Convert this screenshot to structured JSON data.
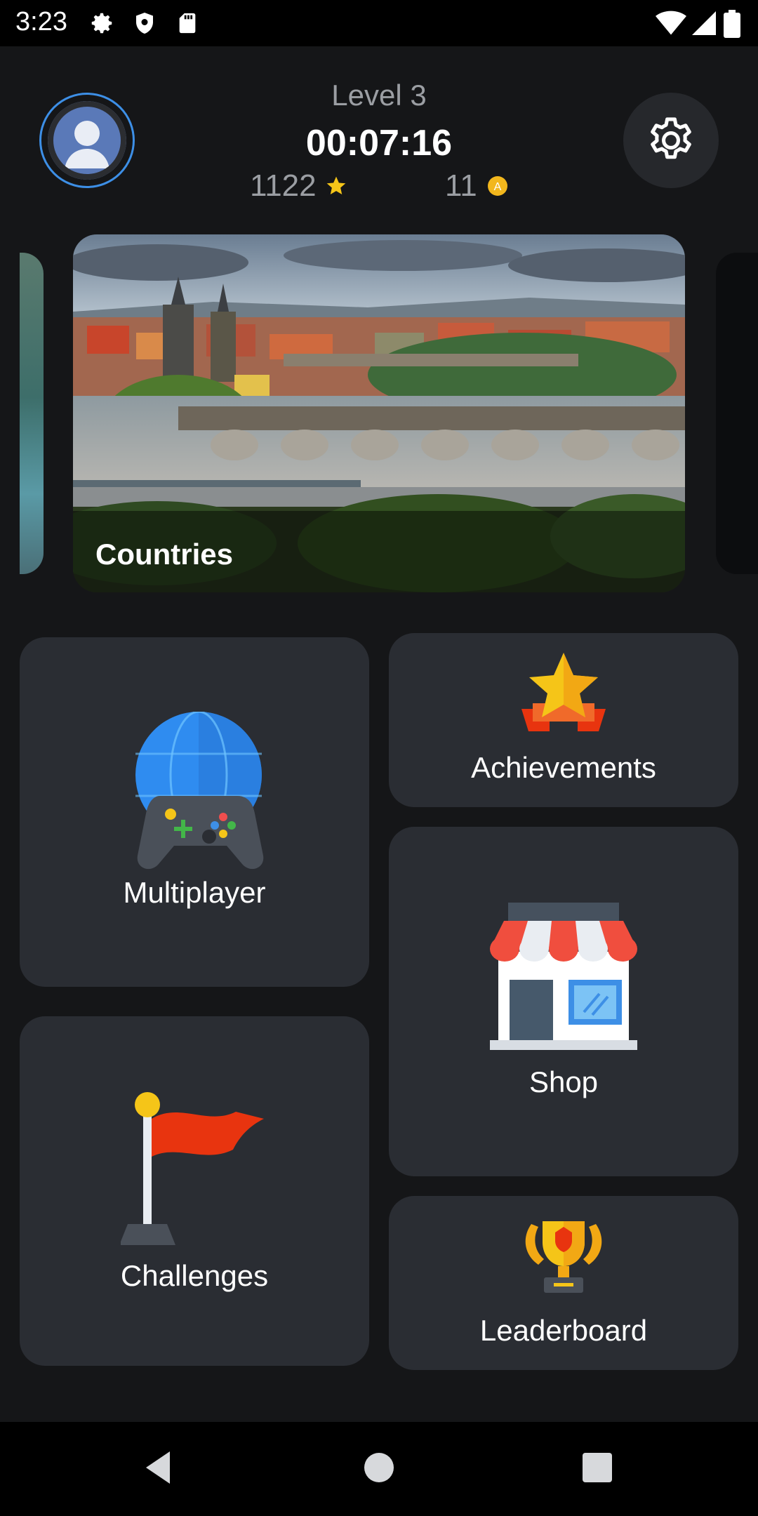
{
  "status_bar": {
    "time": "3:23",
    "icons": [
      "gear-icon",
      "shield-icon",
      "sd-card-icon",
      "wifi-icon",
      "signal-icon",
      "battery-icon"
    ]
  },
  "header": {
    "level": "Level 3",
    "timer": "00:07:16",
    "stars": "1122",
    "coins": "11",
    "coin_symbol": "A"
  },
  "carousel": {
    "current_card": "Countries"
  },
  "menu": {
    "multiplayer": "Multiplayer",
    "achievements": "Achievements",
    "shop": "Shop",
    "challenges": "Challenges",
    "leaderboard": "Leaderboard"
  },
  "colors": {
    "background": "#151618",
    "tile": "#2a2d33",
    "accent_blue": "#3d8fe6",
    "star": "#f5c518",
    "flag_red": "#e8340f"
  }
}
